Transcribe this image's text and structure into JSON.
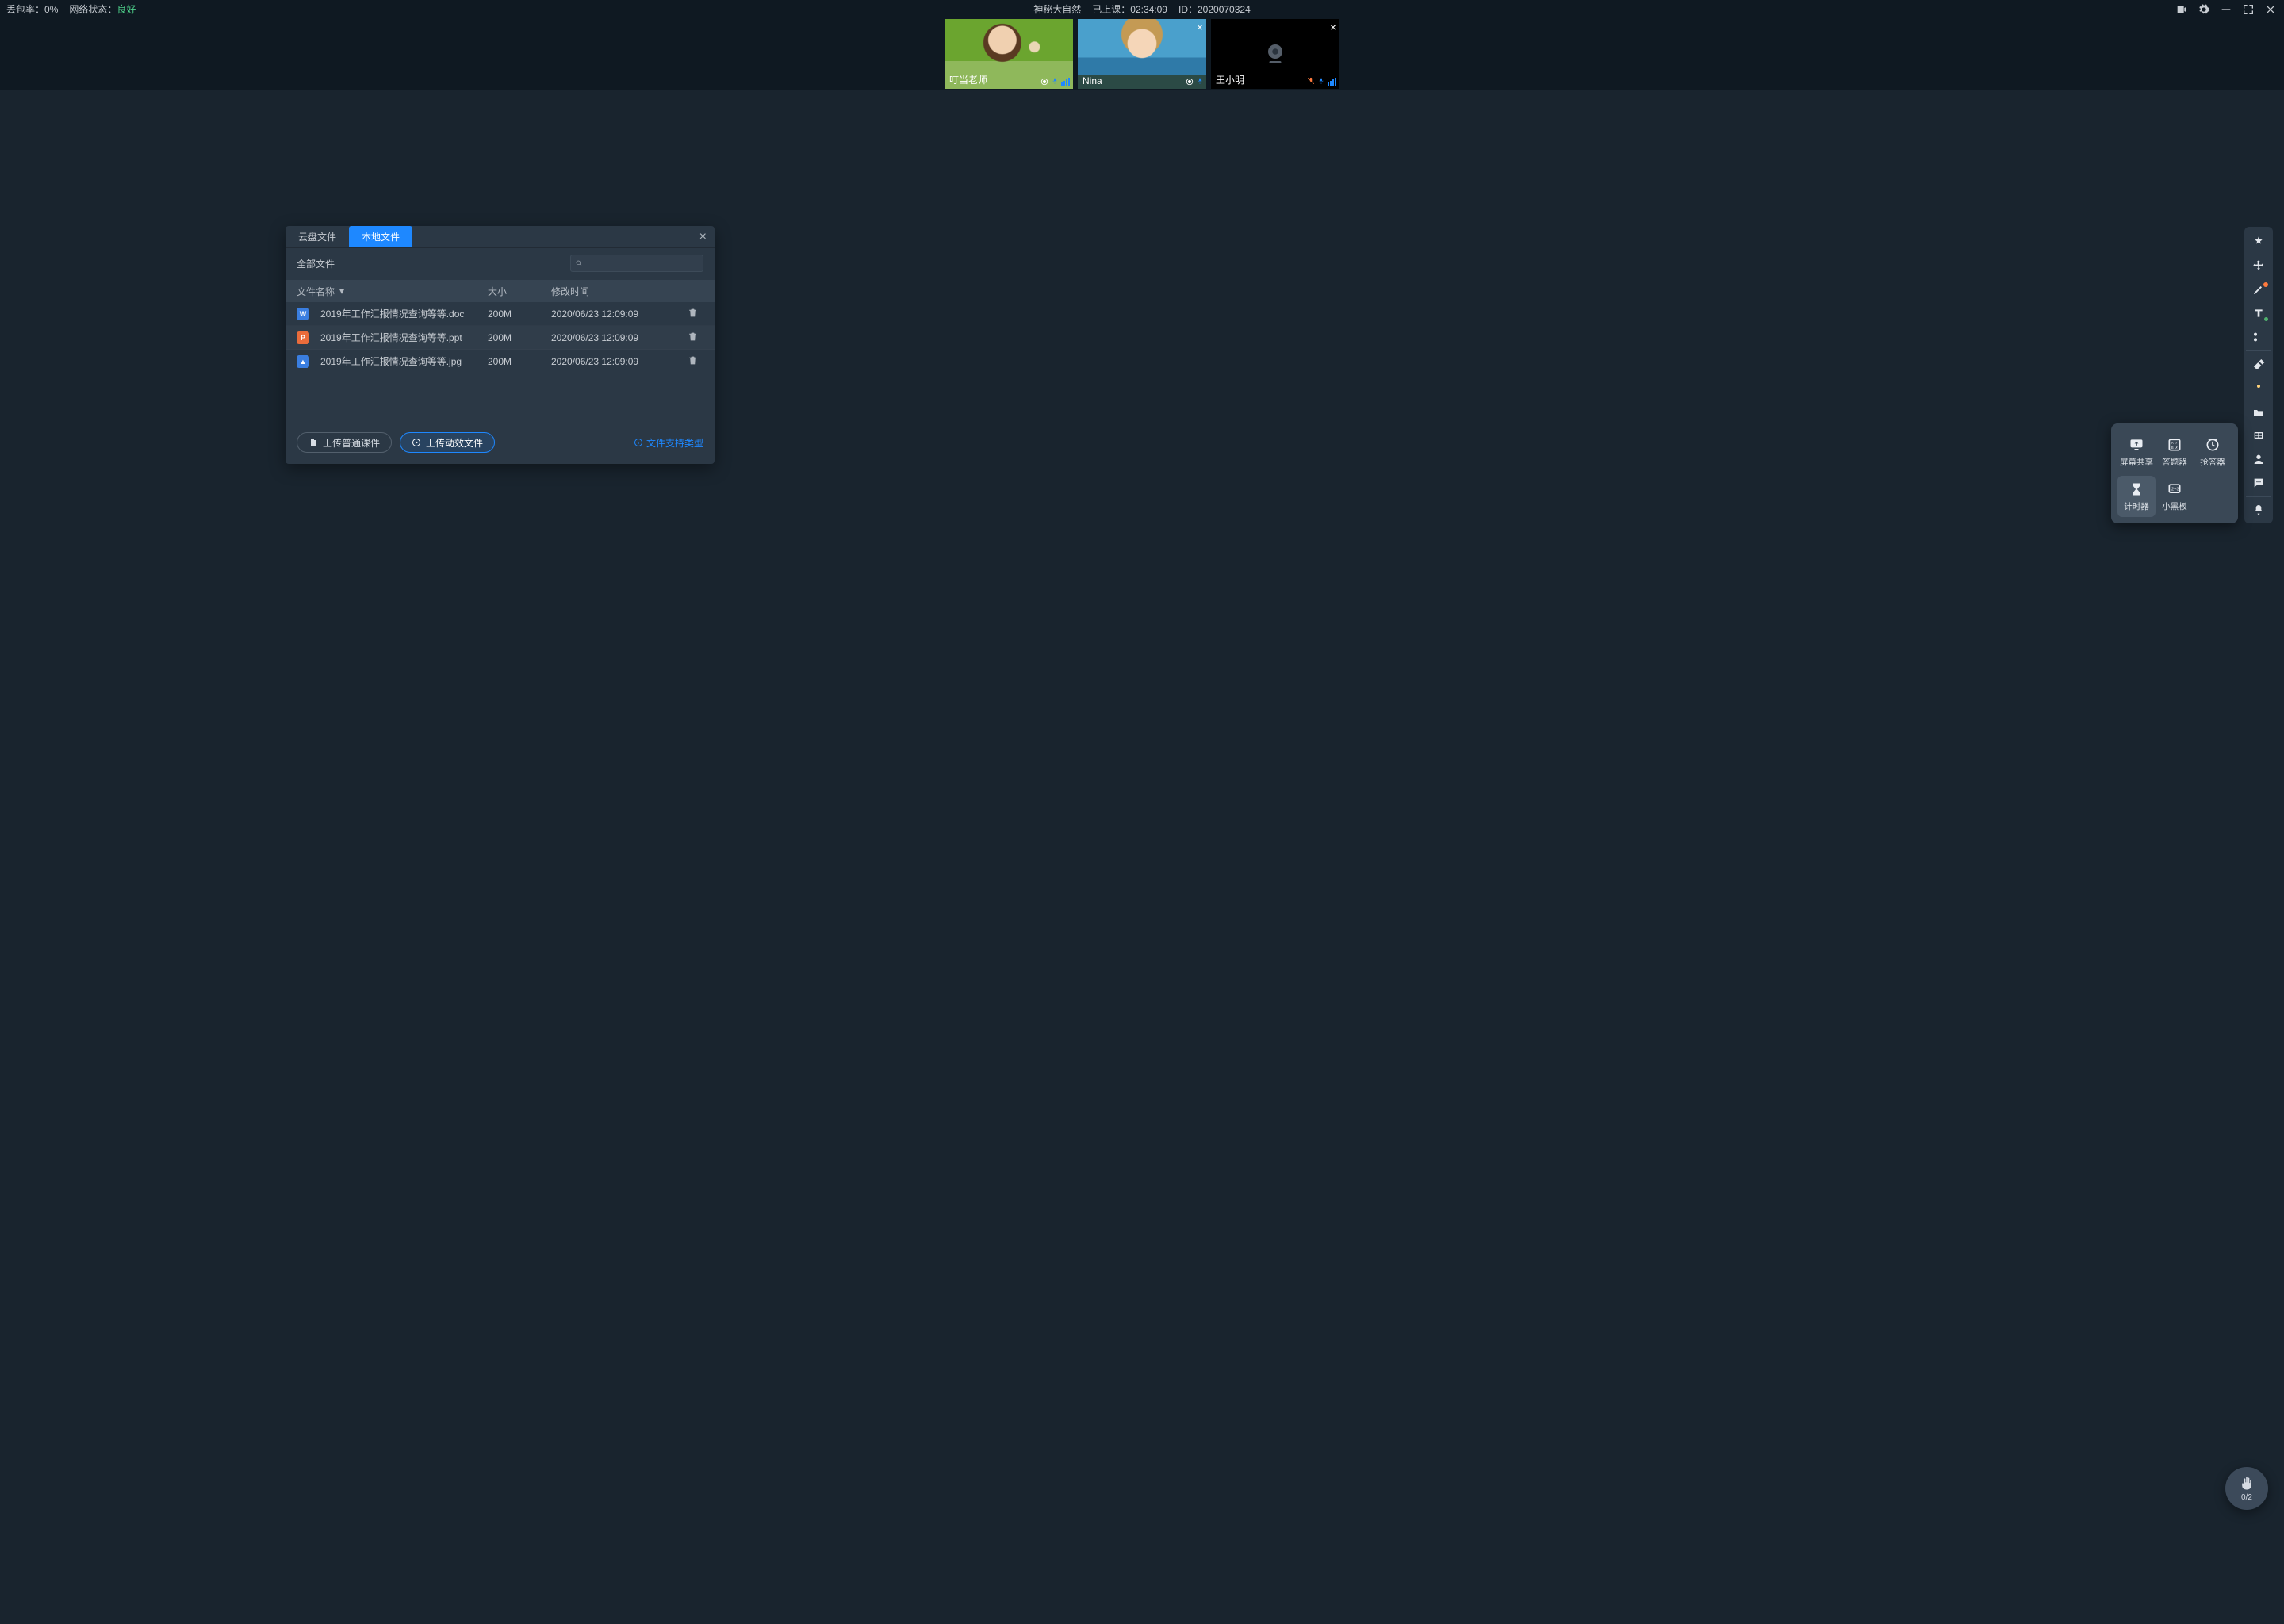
{
  "status": {
    "loss_label": "丢包率：",
    "loss_value": "0%",
    "net_label": "网络状态：",
    "net_value": "良好",
    "title": "神秘大自然",
    "elapsed_label": "已上课：",
    "elapsed_value": "02:34:09",
    "id_label": "ID：",
    "id_value": "2020070324"
  },
  "participants": [
    {
      "name": "叮当老师"
    },
    {
      "name": "Nina"
    },
    {
      "name": "王小明"
    }
  ],
  "dialog": {
    "tabs": {
      "cloud": "云盘文件",
      "local": "本地文件"
    },
    "filter_label": "全部文件",
    "search_placeholder": "",
    "columns": {
      "name": "文件名称",
      "size": "大小",
      "date": "修改时间"
    },
    "rows": [
      {
        "icon": "W",
        "name": "2019年工作汇报情况查询等等.doc",
        "size": "200M",
        "date": "2020/06/23 12:09:09"
      },
      {
        "icon": "P",
        "name": "2019年工作汇报情况查询等等.ppt",
        "size": "200M",
        "date": "2020/06/23 12:09:09"
      },
      {
        "icon": "▲",
        "name": "2019年工作汇报情况查询等等.jpg",
        "size": "200M",
        "date": "2020/06/23 12:09:09"
      }
    ],
    "btn_upload_normal": "上传普通课件",
    "btn_upload_motion": "上传动效文件",
    "supported_link": "文件支持类型"
  },
  "tools_popup": {
    "screen_share": "屏幕共享",
    "answer": "答题器",
    "buzz": "抢答器",
    "timer": "计时器",
    "blackboard": "小黑板"
  },
  "fab": {
    "count": "0/2"
  }
}
